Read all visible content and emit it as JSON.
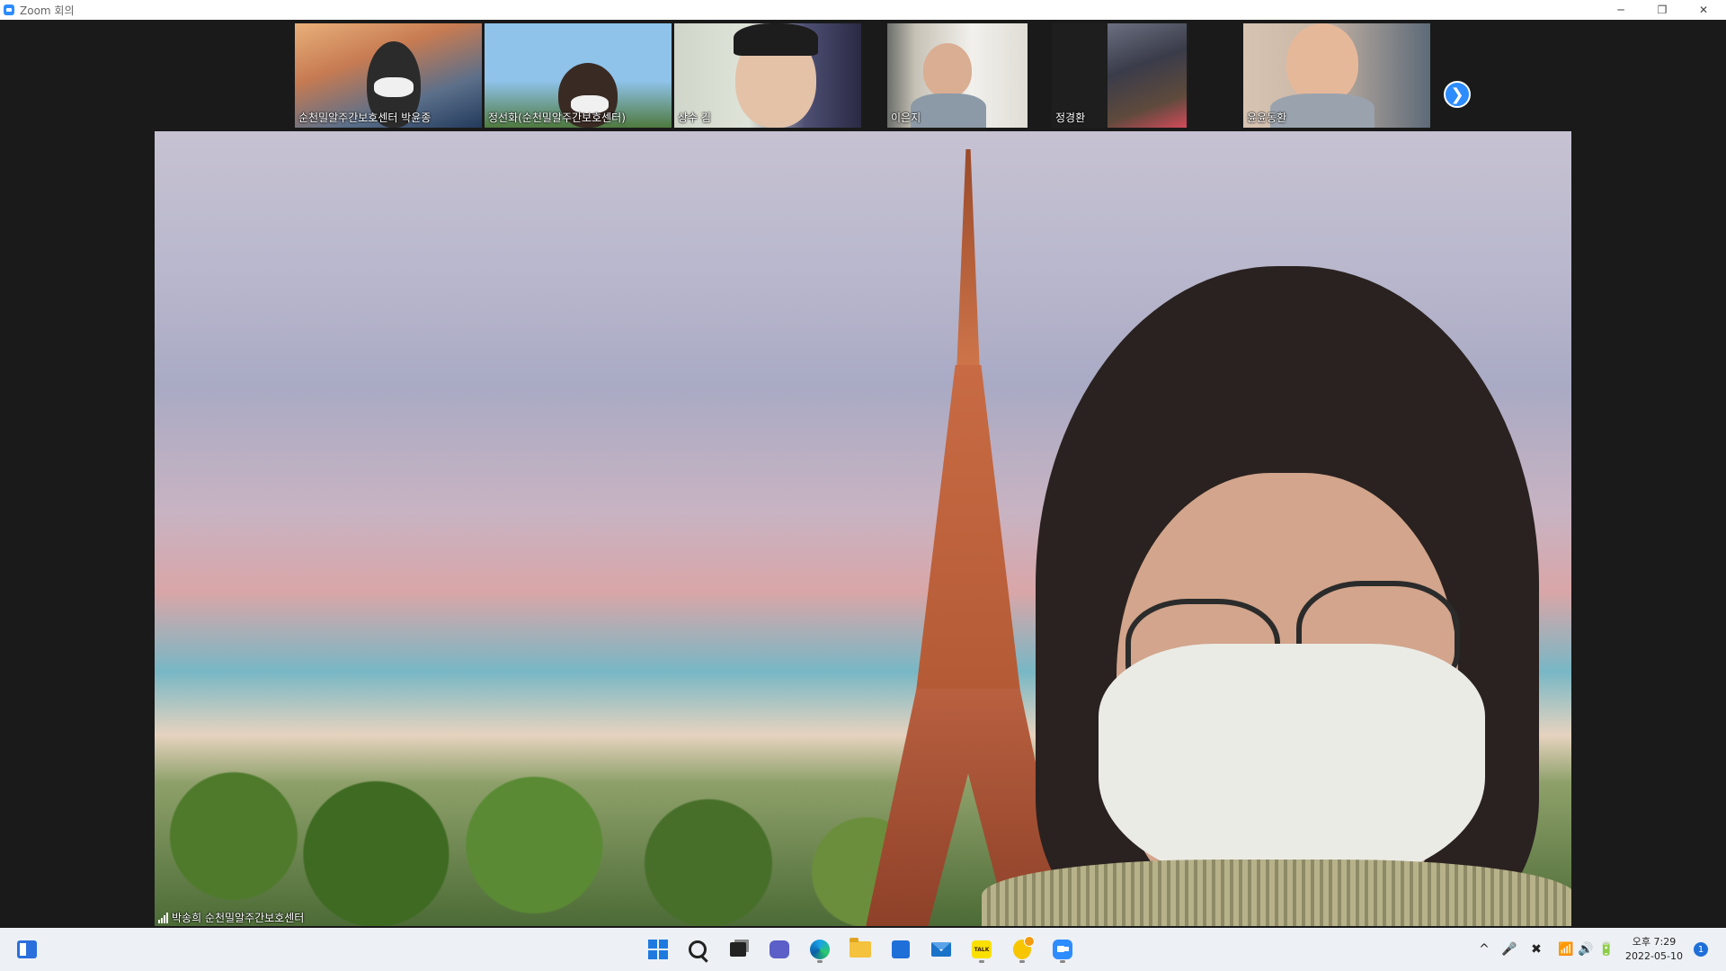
{
  "window": {
    "title": "Zoom 회의",
    "controls": [
      {
        "name": "minimize-button",
        "label": "Minimize",
        "glyph": "─"
      },
      {
        "name": "maximize-button",
        "label": "Restore",
        "glyph": "❐"
      },
      {
        "name": "close-button",
        "label": "Close",
        "glyph": "✕"
      }
    ]
  },
  "participants": [
    {
      "name": "순천밀알주간보호센터 박윤종"
    },
    {
      "name": "정선화(순천밀알주간보호센터)"
    },
    {
      "name": "상수 김"
    },
    {
      "name": "이은지"
    },
    {
      "name": "정경환"
    },
    {
      "name": "윤윤동환"
    }
  ],
  "strip": {
    "next_glyph": "❯"
  },
  "active_speaker": {
    "name": "박송희 순천밀알주간보호센터",
    "virtual_background": "eiffel-tower"
  },
  "taskbar": {
    "items": [
      {
        "name": "widgets-icon",
        "label": "Widgets"
      },
      {
        "name": "start-icon",
        "label": "Start"
      },
      {
        "name": "search-icon",
        "label": "Search"
      },
      {
        "name": "task-view-icon",
        "label": "Task View"
      },
      {
        "name": "chat-icon",
        "label": "Chat"
      },
      {
        "name": "edge-icon",
        "label": "Microsoft Edge"
      },
      {
        "name": "file-explorer-icon",
        "label": "File Explorer"
      },
      {
        "name": "store-icon",
        "label": "Microsoft Store"
      },
      {
        "name": "mail-icon",
        "label": "Mail"
      },
      {
        "name": "kakaotalk-icon",
        "label": "KakaoTalk",
        "text": "TALK"
      },
      {
        "name": "kakaostory-icon",
        "label": "KakaoStory"
      },
      {
        "name": "zoom-icon",
        "label": "Zoom"
      }
    ],
    "tray": {
      "chevron": "^",
      "mic": "🎤",
      "close_circle": "✖",
      "wifi": "📶",
      "volume": "🔊",
      "battery": "🔋"
    },
    "clock": {
      "time": "오후 7:29",
      "date": "2022-05-10"
    },
    "notification_count": "1"
  },
  "colors": {
    "accent": "#2d8cff",
    "titlebar_bg": "#ffffff",
    "meeting_bg": "#1a1a1a",
    "taskbar_bg": "#edf0f5"
  }
}
